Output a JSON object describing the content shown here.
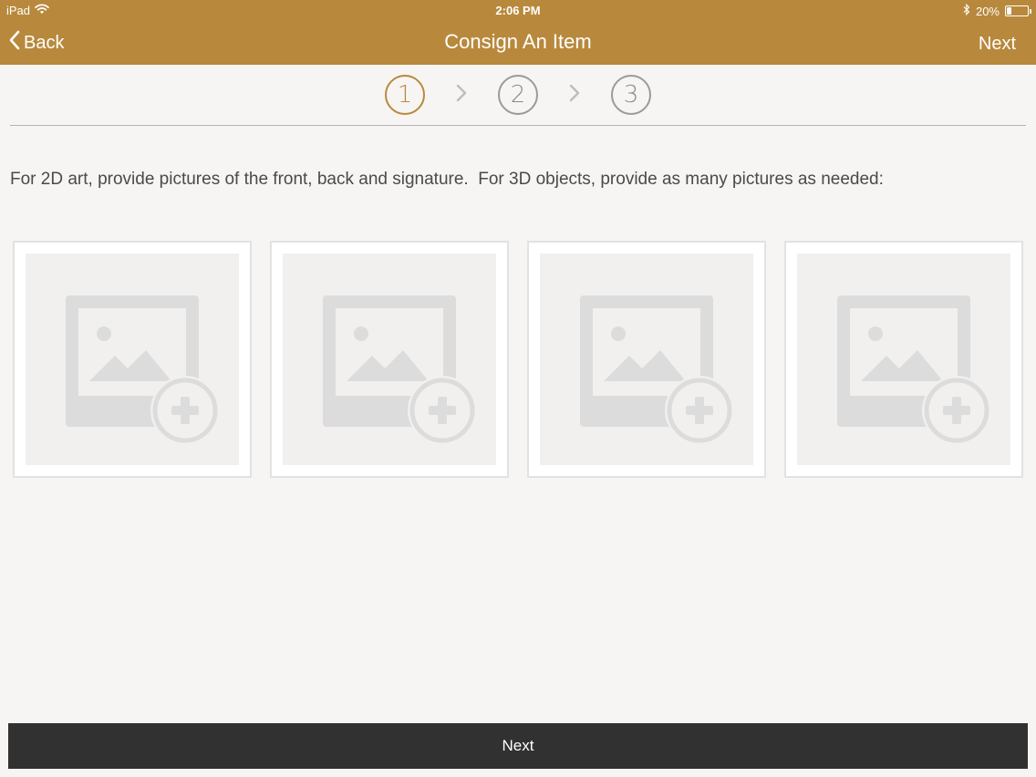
{
  "status_bar": {
    "device": "iPad",
    "time": "2:06 PM",
    "battery": "20%",
    "battery_level": 0.2,
    "icons": [
      "wifi-icon",
      "bluetooth-icon",
      "battery-icon"
    ]
  },
  "nav": {
    "back_label": "Back",
    "title": "Consign An Item",
    "next_label": "Next"
  },
  "steps": [
    "1",
    "2",
    "3"
  ],
  "active_step": 1,
  "instructions": "For 2D art, provide pictures of the front, back and signature.  For 3D objects, provide as many pictures as needed:",
  "photo_slots": [
    {
      "icon": "add-photo-icon"
    },
    {
      "icon": "add-photo-icon"
    },
    {
      "icon": "add-photo-icon"
    },
    {
      "icon": "add-photo-icon"
    }
  ],
  "bottom_button": {
    "label": "Next"
  },
  "colors": {
    "header": "#b8893c",
    "active_step": "#b8893c",
    "background": "#f6f5f3",
    "bottom_bar": "#313131",
    "placeholder": "#dcdcdc"
  }
}
